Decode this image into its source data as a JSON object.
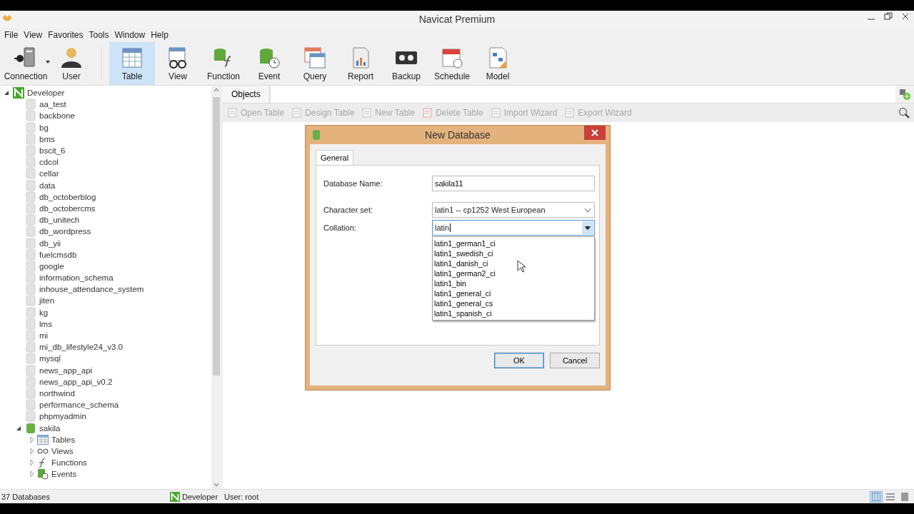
{
  "window": {
    "title": "Navicat Premium"
  },
  "menu": [
    "File",
    "View",
    "Favorites",
    "Tools",
    "Window",
    "Help"
  ],
  "toolbar": [
    {
      "kind": "connection",
      "label": "Connection",
      "selected": false,
      "dropdown": true
    },
    {
      "kind": "user",
      "label": "User",
      "selected": false,
      "dropdown": false
    },
    {
      "kind": "table",
      "label": "Table",
      "selected": true,
      "dropdown": false
    },
    {
      "kind": "view",
      "label": "View",
      "selected": false,
      "dropdown": false
    },
    {
      "kind": "function",
      "label": "Function",
      "selected": false,
      "dropdown": false
    },
    {
      "kind": "event",
      "label": "Event",
      "selected": false,
      "dropdown": false
    },
    {
      "kind": "query",
      "label": "Query",
      "selected": false,
      "dropdown": false
    },
    {
      "kind": "report",
      "label": "Report",
      "selected": false,
      "dropdown": false
    },
    {
      "kind": "backup",
      "label": "Backup",
      "selected": false,
      "dropdown": false
    },
    {
      "kind": "schedule",
      "label": "Schedule",
      "selected": false,
      "dropdown": false
    },
    {
      "kind": "model",
      "label": "Model",
      "selected": false,
      "dropdown": false
    }
  ],
  "tree": [
    {
      "kind": "connection",
      "label": "Developer",
      "expanded": true,
      "children": [
        {
          "kind": "database",
          "label": "aa_test",
          "open": false
        },
        {
          "kind": "database",
          "label": "backbone",
          "open": false
        },
        {
          "kind": "database",
          "label": "bg",
          "open": false
        },
        {
          "kind": "database",
          "label": "bms",
          "open": false
        },
        {
          "kind": "database",
          "label": "bscit_6",
          "open": false
        },
        {
          "kind": "database",
          "label": "cdcol",
          "open": false
        },
        {
          "kind": "database",
          "label": "cellar",
          "open": false
        },
        {
          "kind": "database",
          "label": "data",
          "open": false
        },
        {
          "kind": "database",
          "label": "db_octoberblog",
          "open": false
        },
        {
          "kind": "database",
          "label": "db_octobercms",
          "open": false
        },
        {
          "kind": "database",
          "label": "db_unitech",
          "open": false
        },
        {
          "kind": "database",
          "label": "db_wordpress",
          "open": false
        },
        {
          "kind": "database",
          "label": "db_yii",
          "open": false
        },
        {
          "kind": "database",
          "label": "fuelcmsdb",
          "open": false
        },
        {
          "kind": "database",
          "label": "google",
          "open": false
        },
        {
          "kind": "database",
          "label": "information_schema",
          "open": false
        },
        {
          "kind": "database",
          "label": "inhouse_attendance_system",
          "open": false
        },
        {
          "kind": "database",
          "label": "jiten",
          "open": false
        },
        {
          "kind": "database",
          "label": "kg",
          "open": false
        },
        {
          "kind": "database",
          "label": "lms",
          "open": false
        },
        {
          "kind": "database",
          "label": "mi",
          "open": false
        },
        {
          "kind": "database",
          "label": "mi_db_lifestyle24_v3.0",
          "open": false
        },
        {
          "kind": "database",
          "label": "mysql",
          "open": false
        },
        {
          "kind": "database",
          "label": "news_app_api",
          "open": false
        },
        {
          "kind": "database",
          "label": "news_app_api_v0.2",
          "open": false
        },
        {
          "kind": "database",
          "label": "northwind",
          "open": false
        },
        {
          "kind": "database",
          "label": "performance_schema",
          "open": false
        },
        {
          "kind": "database",
          "label": "phpmyadmin",
          "open": false
        },
        {
          "kind": "database",
          "label": "sakila",
          "open": true,
          "expanded": true,
          "children": [
            {
              "kind": "tables",
              "label": "Tables",
              "expanded": false
            },
            {
              "kind": "views",
              "label": "Views",
              "expanded": false
            },
            {
              "kind": "functions",
              "label": "Functions",
              "expanded": false
            },
            {
              "kind": "events",
              "label": "Events",
              "expanded": false
            }
          ]
        }
      ]
    }
  ],
  "objects_tab": {
    "label": "Objects",
    "selected": true
  },
  "object_actions": [
    {
      "kind": "open",
      "label": "Open Table",
      "disabled": true
    },
    {
      "kind": "design",
      "label": "Design Table",
      "disabled": true
    },
    {
      "kind": "new",
      "label": "New Table",
      "disabled": true
    },
    {
      "kind": "delete",
      "label": "Delete Table",
      "disabled": true
    },
    {
      "kind": "import",
      "label": "Import Wizard",
      "disabled": true
    },
    {
      "kind": "export",
      "label": "Export Wizard",
      "disabled": true
    }
  ],
  "dialog": {
    "title": "New Database",
    "tabs": [
      {
        "label": "General",
        "selected": true
      }
    ],
    "fields": [
      {
        "kind": "text",
        "label": "Database Name:",
        "value": "sakila11",
        "focused": false
      },
      {
        "kind": "select",
        "label": "Character set:",
        "value": "latin1 -- cp1252 West European",
        "focused": false
      },
      {
        "kind": "combo",
        "label": "Collation:",
        "value": "latin",
        "focused": true,
        "options": [
          "latin1_german1_ci",
          "latin1_swedish_ci",
          "latin1_danish_ci",
          "latin1_german2_ci",
          "latin1_bin",
          "latin1_general_ci",
          "latin1_general_cs",
          "latin1_spanish_ci"
        ]
      }
    ],
    "buttons": [
      {
        "label": "OK",
        "default": true
      },
      {
        "label": "Cancel",
        "default": false
      }
    ]
  },
  "status_bar": {
    "count": "37 Databases",
    "connection": "Developer",
    "user": "User: root",
    "views": [
      {
        "kind": "grid",
        "selected": true
      },
      {
        "kind": "list",
        "selected": false
      },
      {
        "kind": "detail",
        "selected": false
      }
    ]
  }
}
